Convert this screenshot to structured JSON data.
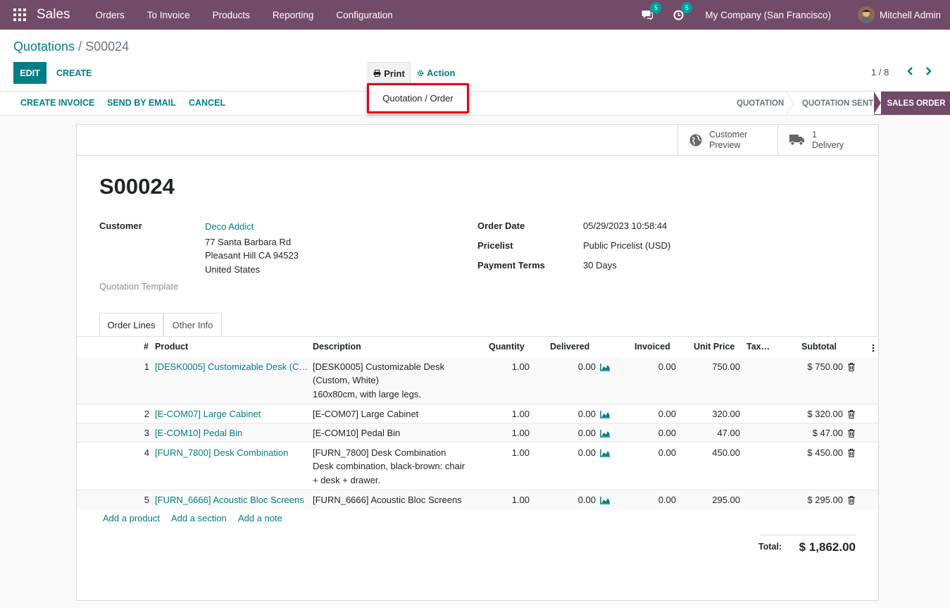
{
  "navbar": {
    "app_name": "Sales",
    "menu": [
      "Orders",
      "To Invoice",
      "Products",
      "Reporting",
      "Configuration"
    ],
    "messages_count": "5",
    "activities_count": "5",
    "company": "My Company (San Francisco)",
    "user": "Mitchell Admin"
  },
  "breadcrumb": {
    "parent": "Quotations",
    "separator": "/",
    "current": "S00024"
  },
  "toolbar": {
    "edit": "EDIT",
    "create": "CREATE",
    "print": "Print",
    "action": "Action"
  },
  "pager": {
    "value": "1 / 8"
  },
  "print_menu": {
    "item": "Quotation / Order"
  },
  "statusbar": {
    "buttons": [
      "CREATE INVOICE",
      "SEND BY EMAIL",
      "CANCEL"
    ],
    "stages": [
      "QUOTATION",
      "QUOTATION SENT",
      "SALES ORDER"
    ],
    "active_stage": "SALES ORDER"
  },
  "smart_buttons": {
    "preview_line1": "Customer",
    "preview_line2": "Preview",
    "delivery_count": "1",
    "delivery_label": "Delivery"
  },
  "order": {
    "name": "S00024",
    "customer_label": "Customer",
    "customer_name": "Deco Addict",
    "address": [
      "77 Santa Barbara Rd",
      "Pleasant Hill CA 94523",
      "United States"
    ],
    "template_label": "Quotation Template",
    "order_date_label": "Order Date",
    "order_date": "05/29/2023 10:58:44",
    "pricelist_label": "Pricelist",
    "pricelist": "Public Pricelist (USD)",
    "payment_terms_label": "Payment Terms",
    "payment_terms": "30 Days"
  },
  "tabs": [
    "Order Lines",
    "Other Info"
  ],
  "table": {
    "headers": [
      "#",
      "Product",
      "Description",
      "Quantity",
      "Delivered",
      "Invoiced",
      "Unit Price",
      "Tax…",
      "Subtotal"
    ],
    "rows": [
      {
        "num": "1",
        "product": "[DESK0005] Customizable Desk (Cu…",
        "description": [
          "[DESK0005] Customizable Desk",
          "(Custom, White)",
          "160x80cm, with large legs."
        ],
        "quantity": "1.00",
        "delivered": "0.00",
        "invoiced": "0.00",
        "unit_price": "750.00",
        "subtotal": "$ 750.00"
      },
      {
        "num": "2",
        "product": "[E-COM07] Large Cabinet",
        "description": [
          "[E-COM07] Large Cabinet"
        ],
        "quantity": "1.00",
        "delivered": "0.00",
        "invoiced": "0.00",
        "unit_price": "320.00",
        "subtotal": "$ 320.00"
      },
      {
        "num": "3",
        "product": "[E-COM10] Pedal Bin",
        "description": [
          "[E-COM10] Pedal Bin"
        ],
        "quantity": "1.00",
        "delivered": "0.00",
        "invoiced": "0.00",
        "unit_price": "47.00",
        "subtotal": "$ 47.00"
      },
      {
        "num": "4",
        "product": "[FURN_7800] Desk Combination",
        "description": [
          "[FURN_7800] Desk Combination",
          "Desk combination, black-brown: chair",
          "+ desk + drawer."
        ],
        "quantity": "1.00",
        "delivered": "0.00",
        "invoiced": "0.00",
        "unit_price": "450.00",
        "subtotal": "$ 450.00"
      },
      {
        "num": "5",
        "product": "[FURN_6666] Acoustic Bloc Screens",
        "description": [
          "[FURN_6666] Acoustic Bloc Screens"
        ],
        "quantity": "1.00",
        "delivered": "0.00",
        "invoiced": "0.00",
        "unit_price": "295.00",
        "subtotal": "$ 295.00"
      }
    ]
  },
  "add_links": [
    "Add a product",
    "Add a section",
    "Add a note"
  ],
  "total": {
    "label": "Total:",
    "value": "$ 1,862.00"
  },
  "colors": {
    "brand": "#714b67",
    "accent": "#017e84",
    "highlight": "#e0001b"
  }
}
